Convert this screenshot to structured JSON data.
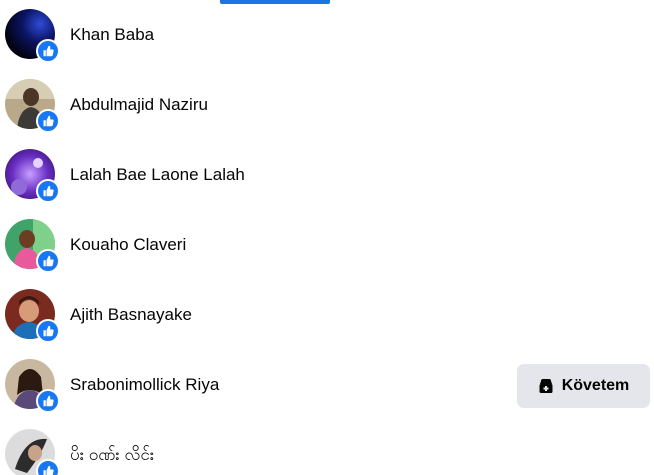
{
  "reactions": [
    {
      "name": "Khan Baba",
      "reaction_icon": "like-icon"
    },
    {
      "name": "Abdulmajid Naziru",
      "reaction_icon": "like-icon"
    },
    {
      "name": "Lalah Bae Laone Lalah",
      "reaction_icon": "like-icon"
    },
    {
      "name": "Kouaho Claveri",
      "reaction_icon": "like-icon"
    },
    {
      "name": "Ajith Basnayake",
      "reaction_icon": "like-icon"
    },
    {
      "name": "Srabonimollick Riya",
      "reaction_icon": "like-icon",
      "action": {
        "label": "Követem",
        "icon": "follow-icon"
      }
    },
    {
      "name": "ပိး ဝဏ်း လိင်း",
      "reaction_icon": "like-icon"
    }
  ],
  "colors": {
    "accent": "#1b74e4",
    "like_badge": "#1877f2",
    "button_bg": "#e4e6eb",
    "text": "#050505"
  }
}
